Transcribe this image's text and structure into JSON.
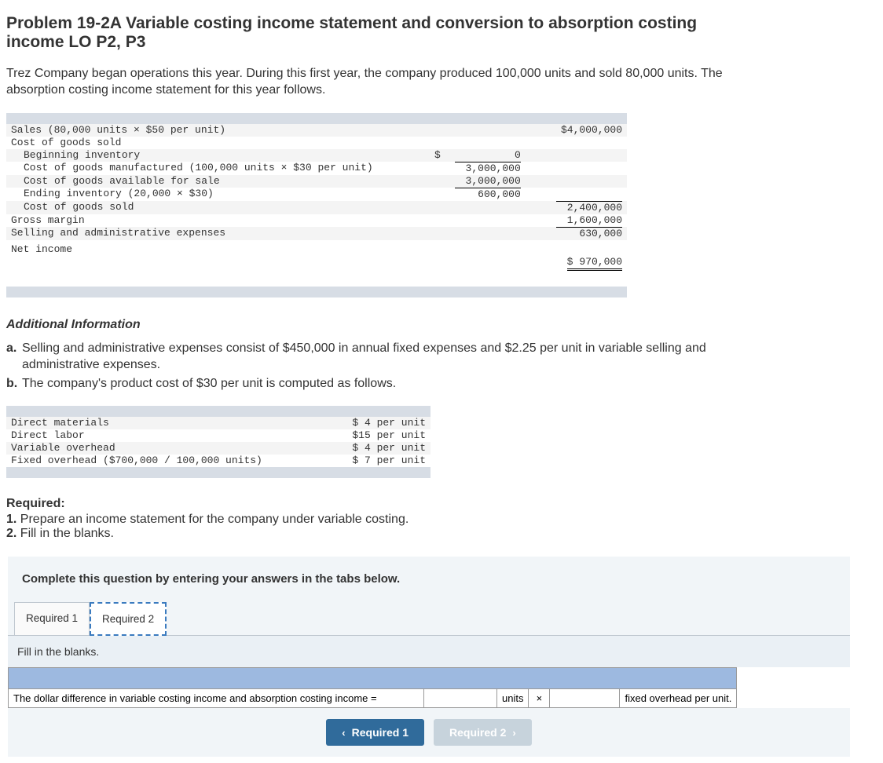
{
  "title": "Problem 19-2A Variable costing income statement and conversion to absorption costing income LO P2, P3",
  "intro": "Trez Company began operations this year. During this first year, the company produced 100,000 units and sold 80,000 units. The absorption costing income statement for this year follows.",
  "income_stmt": {
    "sales_label": "Sales (80,000 units × $50 per unit)",
    "sales_value": "$4,000,000",
    "cogs_label": "Cost of goods sold",
    "beg_inv_label": "Beginning inventory",
    "beg_inv_cur": "$",
    "beg_inv_value": "0",
    "cogm_label": "Cost of goods manufactured (100,000 units × $30 per unit)",
    "cogm_value": "3,000,000",
    "avail_label": "Cost of goods available for sale",
    "avail_value": "3,000,000",
    "end_inv_label": "Ending inventory (20,000 × $30)",
    "end_inv_value": "600,000",
    "cogs_sold_label": "Cost of goods sold",
    "cogs_sold_value": "2,400,000",
    "gm_label": "Gross margin",
    "gm_value": "1,600,000",
    "sae_label": "Selling and administrative expenses",
    "sae_value": "630,000",
    "ni_label": "Net income",
    "ni_cur": "$",
    "ni_value": "970,000"
  },
  "add_info_h": "Additional Information",
  "info_a_marker": "a.",
  "info_a": "Selling and administrative expenses consist of $450,000 in annual fixed expenses and $2.25 per unit in variable selling and administrative expenses.",
  "info_b_marker": "b.",
  "info_b": "The company's product cost of $30 per unit is computed as follows.",
  "product_cost": [
    {
      "label": "Direct materials",
      "val": "$ 4 per unit"
    },
    {
      "label": "Direct labor",
      "val": "$15 per unit"
    },
    {
      "label": "Variable overhead",
      "val": "$ 4 per unit"
    },
    {
      "label": "Fixed overhead ($700,000 / 100,000 units)",
      "val": "$ 7 per unit"
    }
  ],
  "required_h": "Required:",
  "req1_marker": "1.",
  "req1": "Prepare an income statement for the company under variable costing.",
  "req2_marker": "2.",
  "req2": "Fill in the blanks.",
  "answer": {
    "instr": "Complete this question by entering your answers in the tabs below.",
    "tab1": "Required 1",
    "tab2": "Required 2",
    "tab_content_text": "Fill in the blanks.",
    "fill_label": "The dollar difference in variable costing income and absorption costing income =",
    "units_text": "units",
    "times_text": "×",
    "foh_text": "fixed overhead per unit.",
    "prev_caret": "‹",
    "prev_btn": "Required 1",
    "next_btn": "Required 2",
    "next_caret": "›"
  }
}
